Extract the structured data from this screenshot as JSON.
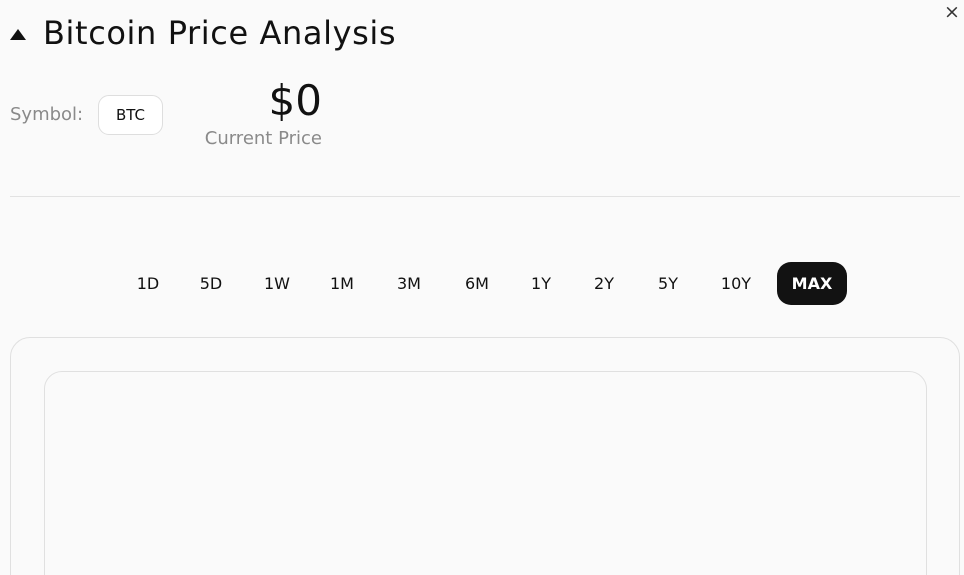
{
  "header": {
    "title": "Bitcoin Price Analysis",
    "collapse_icon": "triangle-up-icon",
    "close_glyph": "×"
  },
  "symbol": {
    "label": "Symbol:",
    "value": "BTC"
  },
  "price": {
    "value": "$0",
    "label": "Current Price"
  },
  "ranges": [
    "1D",
    "5D",
    "1W",
    "1M",
    "3M",
    "6M",
    "1Y",
    "2Y",
    "5Y",
    "10Y",
    "MAX"
  ],
  "active_range": "MAX",
  "colors": {
    "active_bg": "#121212",
    "active_text": "#ffffff",
    "page_bg": "#fafafa"
  }
}
